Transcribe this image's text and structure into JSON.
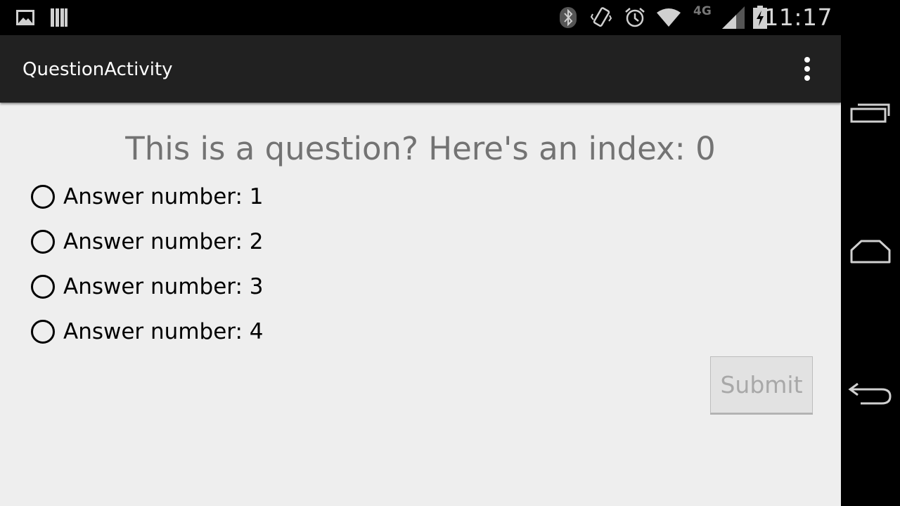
{
  "status_bar": {
    "time": "11:17",
    "network_type": "4G",
    "left_icons": [
      "gallery-icon",
      "storage-icon"
    ],
    "right_icons": [
      "bluetooth-icon",
      "vibrate-icon",
      "alarm-icon",
      "wifi-icon",
      "cell-signal-icon",
      "battery-charging-icon"
    ]
  },
  "action_bar": {
    "title": "QuestionActivity",
    "overflow_icon": "more-vert-icon"
  },
  "question": {
    "text": "This is a question? Here's an index: 0",
    "answers": [
      {
        "label": "Answer number: 1",
        "checked": false
      },
      {
        "label": "Answer number: 2",
        "checked": false
      },
      {
        "label": "Answer number: 3",
        "checked": false
      },
      {
        "label": "Answer number: 4",
        "checked": false
      }
    ],
    "submit_label": "Submit",
    "submit_enabled": false
  },
  "nav_bar": {
    "buttons": [
      "recent-apps-icon",
      "home-icon",
      "back-icon"
    ]
  },
  "colors": {
    "action_bar": "#212121",
    "content_bg": "#eeeeee",
    "question_text": "#737373",
    "status_bar": "#000000"
  }
}
